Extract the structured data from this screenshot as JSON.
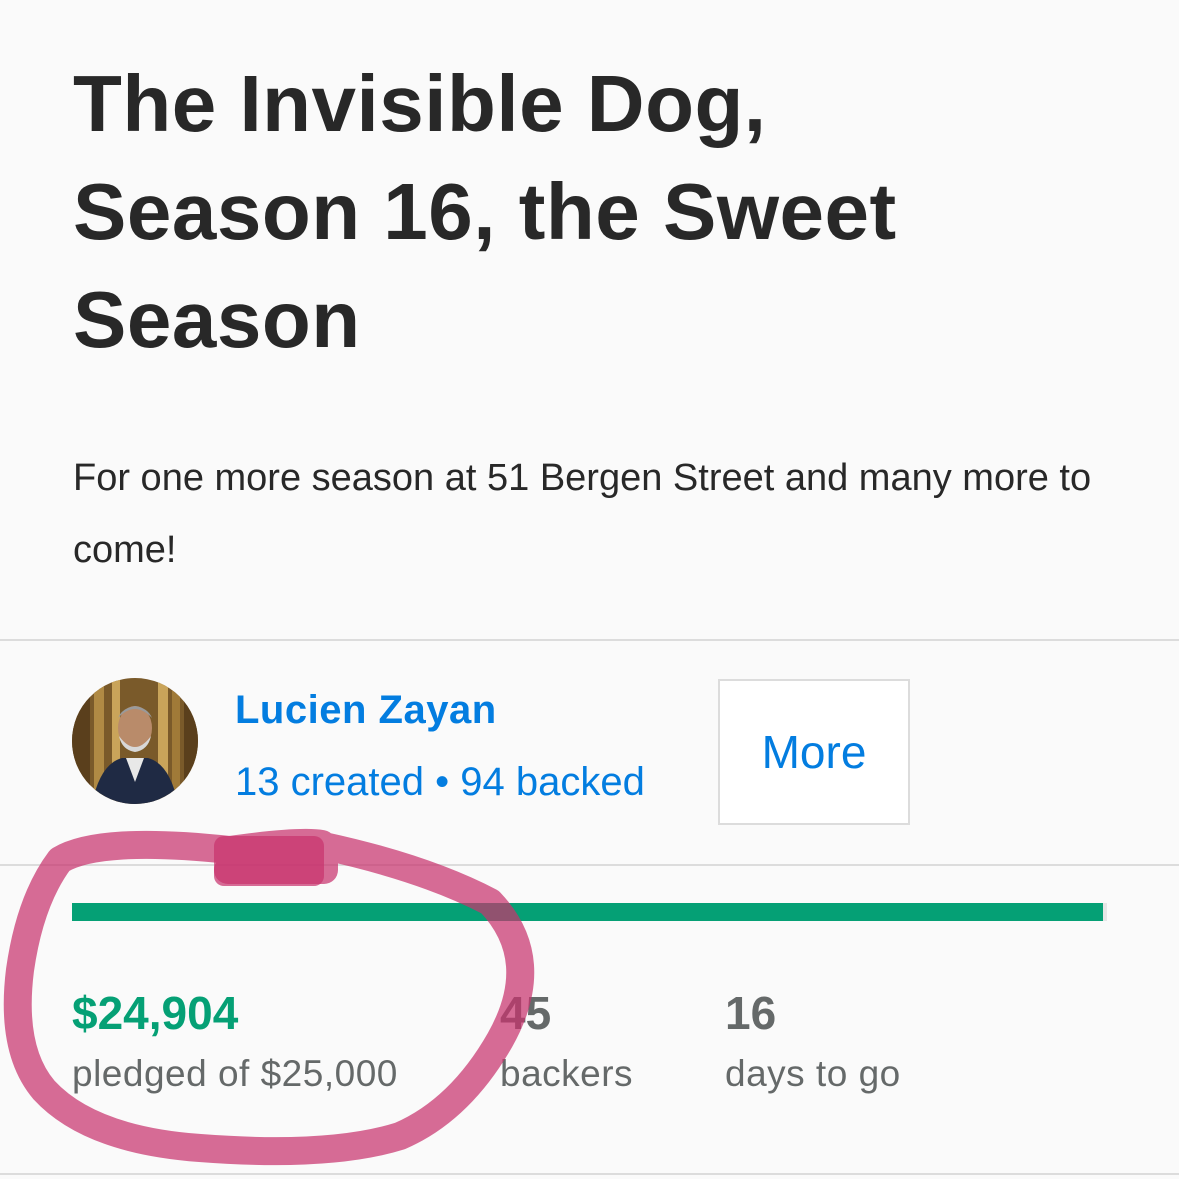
{
  "project": {
    "title": "The Invisible Dog, Season 16, the Sweet Season",
    "blurb": "For one more season at 51 Bergen Street and many more to come!"
  },
  "creator": {
    "name": "Lucien Zayan",
    "created": "13 created",
    "separator": "•",
    "backed": "94 backed",
    "more_label": "More"
  },
  "funding": {
    "progress_fraction": 0.996,
    "pledged": "$24,904",
    "pledged_label": "pledged of $25,000",
    "backers": "45",
    "backers_label": "backers",
    "days": "16",
    "days_label": "days to go"
  },
  "colors": {
    "accent_green": "#05a075",
    "link_blue": "#037de0",
    "annotation_pink": "#c8336e"
  },
  "icons": {
    "avatar": "creator-avatar-photo"
  }
}
